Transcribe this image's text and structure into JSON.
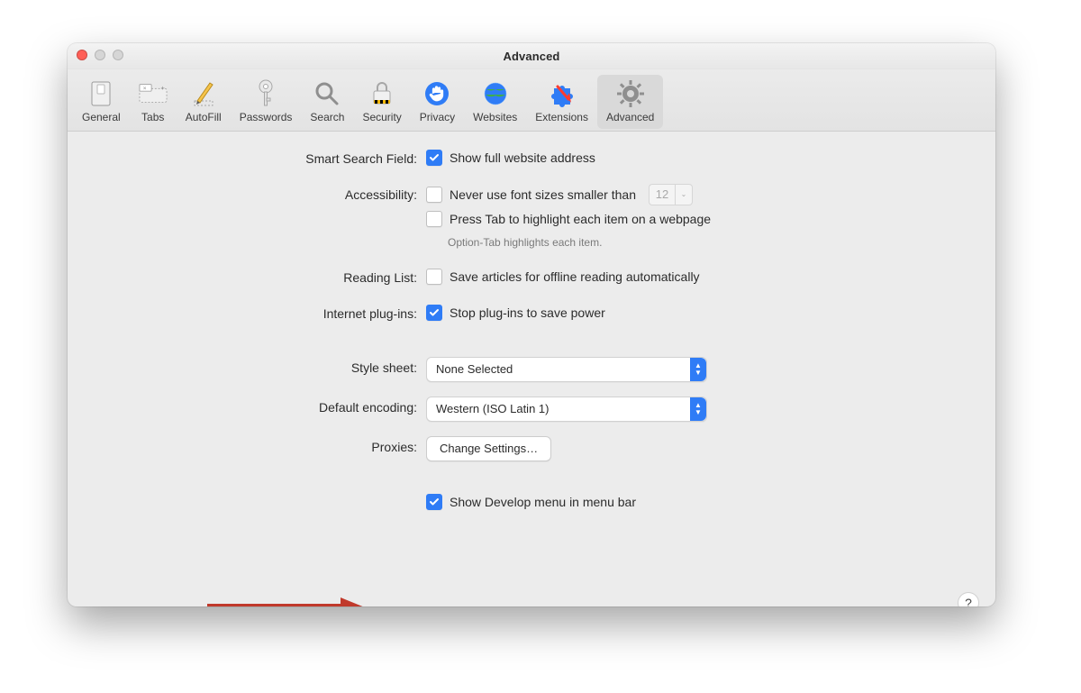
{
  "window": {
    "title": "Advanced"
  },
  "toolbar": {
    "items": [
      {
        "label": "General"
      },
      {
        "label": "Tabs"
      },
      {
        "label": "AutoFill"
      },
      {
        "label": "Passwords"
      },
      {
        "label": "Search"
      },
      {
        "label": "Security"
      },
      {
        "label": "Privacy"
      },
      {
        "label": "Websites"
      },
      {
        "label": "Extensions"
      },
      {
        "label": "Advanced"
      }
    ],
    "selected_index": 9
  },
  "sections": {
    "smart_search": {
      "label": "Smart Search Field:",
      "show_full_address": {
        "label": "Show full website address",
        "checked": true
      }
    },
    "accessibility": {
      "label": "Accessibility:",
      "min_font": {
        "label": "Never use font sizes smaller than",
        "checked": false,
        "value": "12"
      },
      "press_tab": {
        "label": "Press Tab to highlight each item on a webpage",
        "checked": false
      },
      "hint": "Option-Tab highlights each item."
    },
    "reading_list": {
      "label": "Reading List:",
      "save_offline": {
        "label": "Save articles for offline reading automatically",
        "checked": false
      }
    },
    "plugins": {
      "label": "Internet plug-ins:",
      "stop_power": {
        "label": "Stop plug-ins to save power",
        "checked": true
      }
    },
    "style_sheet": {
      "label": "Style sheet:",
      "value": "None Selected"
    },
    "encoding": {
      "label": "Default encoding:",
      "value": "Western (ISO Latin 1)"
    },
    "proxies": {
      "label": "Proxies:",
      "button": "Change Settings…"
    },
    "develop": {
      "label": "Show Develop menu in menu bar",
      "checked": true
    }
  },
  "help_label": "?"
}
